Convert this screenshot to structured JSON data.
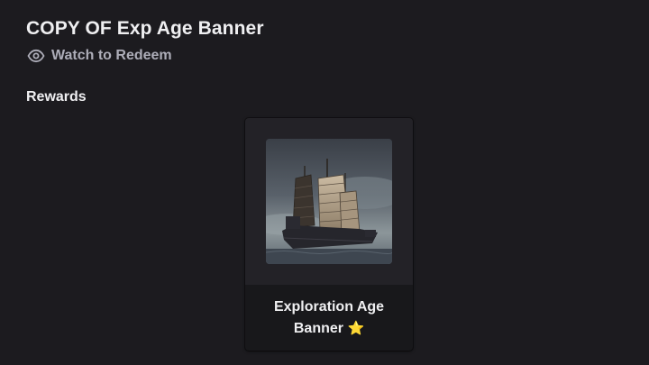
{
  "header": {
    "title": "COPY OF Exp Age Banner",
    "watch_label": "Watch to Redeem",
    "watch_icon": "eye-icon"
  },
  "rewards": {
    "section_label": "Rewards",
    "items": [
      {
        "name_line1": "Exploration Age",
        "name_line2": "Banner",
        "emoji": "⭐",
        "image_icon": "sailing-junk-ship-image"
      }
    ]
  },
  "colors": {
    "background": "#1c1b1f",
    "card": "#18181b",
    "muted_text": "#adadb8",
    "star": "#f5c518"
  }
}
